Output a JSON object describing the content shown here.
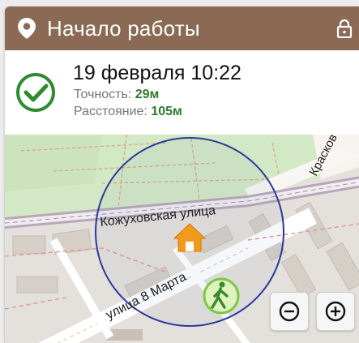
{
  "header": {
    "title": "Начало работы",
    "icon": "location-pin-icon",
    "lock_icon": "lock-icon",
    "color": "#8a6a55"
  },
  "info": {
    "status_icon": "check-circle-icon",
    "status_color": "#2e8b2e",
    "datetime": "19 февраля 10:22",
    "accuracy_label": "Точность:",
    "accuracy_value": "29м",
    "distance_label": "Расстояние:",
    "distance_value": "105м",
    "value_color": "#2c7a2c"
  },
  "map": {
    "street_labels": {
      "kozhukhovskaya": "Кожуховская улица",
      "march8": "улица 8 Марта",
      "krasko": "Красков"
    },
    "markers": {
      "work_place": "home-marker-icon",
      "user": "walking-person-icon"
    },
    "radius_circle_color": "#2a3a9a",
    "zoom_out_label": "⊖",
    "zoom_in_label": "⊕"
  }
}
